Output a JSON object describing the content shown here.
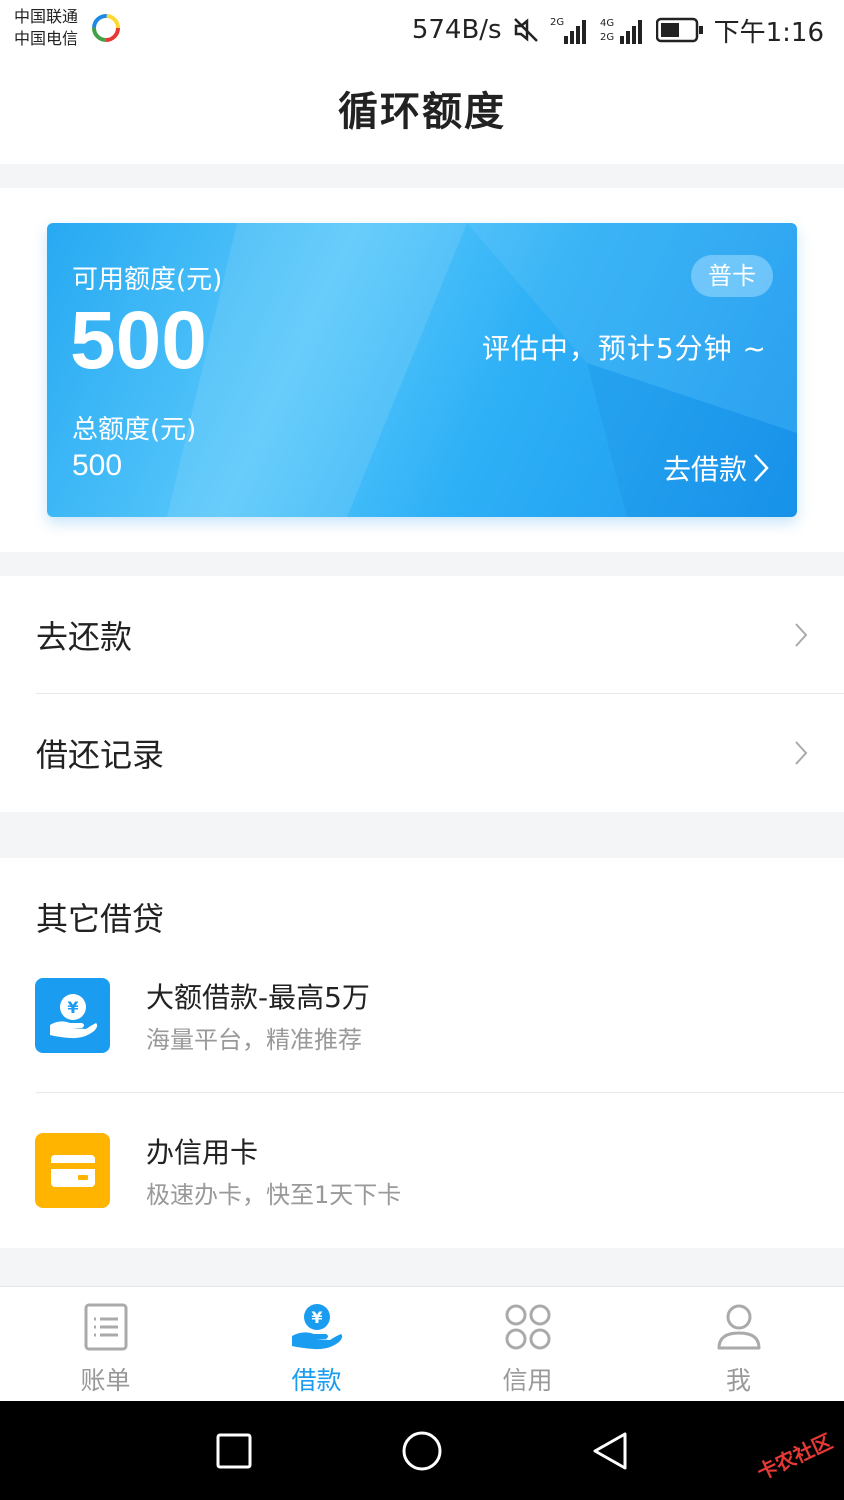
{
  "status_bar": {
    "carrier_1": "中国联通",
    "carrier_2": "中国电信",
    "net_speed": "574B/s",
    "network_1": "2G",
    "network_2": "4G",
    "network_3": "2G",
    "time": "下午1:16"
  },
  "header": {
    "title": "循环额度"
  },
  "card": {
    "available_label": "可用额度(元)",
    "available_amount": "500",
    "total_label": "总额度(元)",
    "total_amount": "500",
    "badge": "普卡",
    "status": "评估中，预计5分钟 ~",
    "borrow_label": "去借款",
    "colors": {
      "start": "#27a9f2",
      "end": "#1a98ee"
    }
  },
  "menu": [
    {
      "label": "去还款"
    },
    {
      "label": "借还记录"
    }
  ],
  "other_loans": {
    "title": "其它借贷",
    "items": [
      {
        "title": "大额借款-最高5万",
        "subtitle": "海量平台，精准推荐",
        "icon": "yuan-hand-icon",
        "color": "#1a9cf0"
      },
      {
        "title": "办信用卡",
        "subtitle": "极速办卡，快至1天下卡",
        "icon": "card-icon",
        "color": "#ffb400"
      }
    ]
  },
  "tabs": [
    {
      "label": "账单",
      "icon": "bill-icon",
      "active": false
    },
    {
      "label": "借款",
      "icon": "loan-icon",
      "active": true
    },
    {
      "label": "信用",
      "icon": "credit-icon",
      "active": false
    },
    {
      "label": "我",
      "icon": "profile-icon",
      "active": false
    }
  ],
  "accent_color": "#1a9cf0",
  "watermark": "卡农社区"
}
